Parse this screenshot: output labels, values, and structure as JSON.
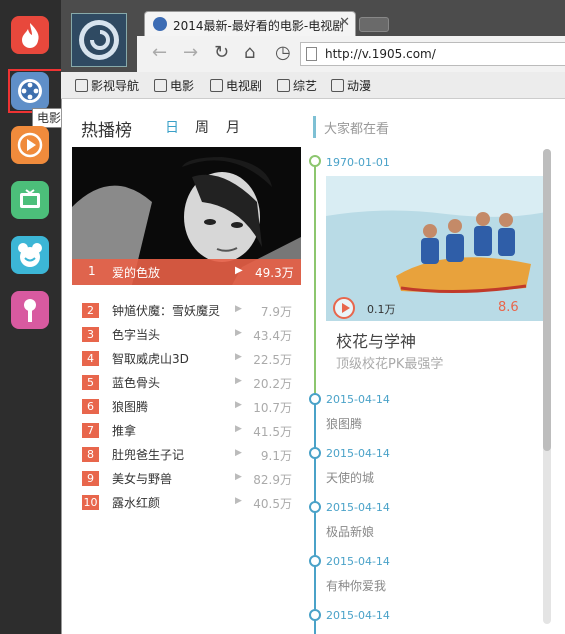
{
  "tooltip": "电影",
  "browser": {
    "tab_title": "2014最新-最好看的电影-电视剧",
    "tab_close": "✕",
    "url": "http://v.1905.com/",
    "bookmarks": [
      "影视导航",
      "电影",
      "电视剧",
      "综艺",
      "动漫"
    ]
  },
  "ranking": {
    "title": "热播榜",
    "periods": [
      "日",
      "周",
      "月"
    ],
    "active_period": "日",
    "featured": {
      "rank": "1",
      "title": "爱的色放",
      "count": "49.3万"
    },
    "items": [
      {
        "rank": "2",
        "title": "钟馗伏魔：雪妖魔灵",
        "count": "7.9万"
      },
      {
        "rank": "3",
        "title": "色字当头",
        "count": "43.4万"
      },
      {
        "rank": "4",
        "title": "智取威虎山3D",
        "count": "22.5万"
      },
      {
        "rank": "5",
        "title": "蓝色骨头",
        "count": "20.2万"
      },
      {
        "rank": "6",
        "title": "狼图腾",
        "count": "10.7万"
      },
      {
        "rank": "7",
        "title": "推拿",
        "count": "41.5万"
      },
      {
        "rank": "8",
        "title": "肚兜爸生子记",
        "count": "9.1万"
      },
      {
        "rank": "9",
        "title": "美女与野兽",
        "count": "82.9万"
      },
      {
        "rank": "10",
        "title": "露水红颜",
        "count": "40.5万"
      }
    ]
  },
  "watching": {
    "title": "大家都在看",
    "card": {
      "date": "1970-01-01",
      "count": "0.1万",
      "score": "8.6",
      "title": "校花与学神",
      "subtitle": "顶级校花PK最强学"
    },
    "timeline": [
      {
        "date": "2015-04-14",
        "title": "狼图腾"
      },
      {
        "date": "2015-04-14",
        "title": "天使的城"
      },
      {
        "date": "2015-04-14",
        "title": "极品新娘"
      },
      {
        "date": "2015-04-14",
        "title": "有种你爱我"
      },
      {
        "date": "2015-04-14",
        "title": ""
      }
    ]
  },
  "colors": {
    "accent": "#3aa0c8",
    "rank": "#e8664c",
    "timeline_green": "#8cc66e"
  }
}
